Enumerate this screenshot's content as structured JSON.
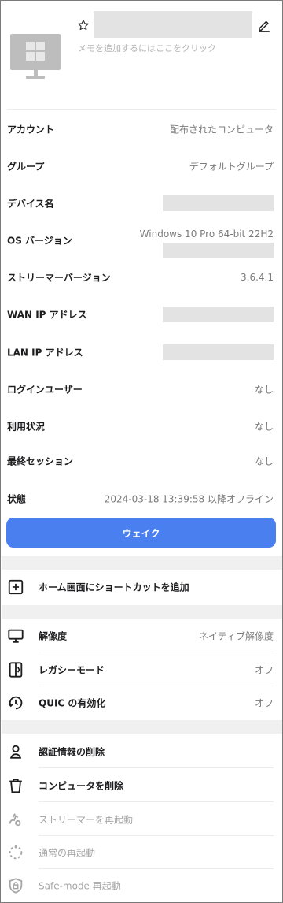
{
  "header": {
    "memo_placeholder": "メモを追加するにはここをクリック",
    "device_icon": "monitor-windows-icon",
    "star_icon": "star-outline-icon",
    "edit_icon": "pencil-icon"
  },
  "info": {
    "account": {
      "label": "アカウント",
      "value": "配布されたコンピュータ"
    },
    "group": {
      "label": "グループ",
      "value": "デフォルトグループ"
    },
    "device_name": {
      "label": "デバイス名"
    },
    "os_version": {
      "label": "OS バージョン",
      "value": "Windows 10 Pro 64-bit 22H2"
    },
    "streamer_version": {
      "label": "ストリーマーバージョン",
      "value": "3.6.4.1"
    },
    "wan_ip": {
      "label": "WAN IP アドレス"
    },
    "lan_ip": {
      "label": "LAN IP アドレス"
    },
    "login_user": {
      "label": "ログインユーザー",
      "value": "なし"
    },
    "usage": {
      "label": "利用状況",
      "value": "なし"
    },
    "last_session": {
      "label": "最終セッション",
      "value": "なし"
    },
    "status": {
      "label": "状態",
      "value": "2024-03-18 13:39:58 以降オフライン"
    }
  },
  "wake_button": {
    "label": "ウェイク"
  },
  "actions": {
    "add_shortcut": {
      "label": "ホーム画面にショートカットを追加",
      "icon": "plus-box-icon"
    },
    "resolution": {
      "label": "解像度",
      "value": "ネイティブ解像度",
      "icon": "monitor-icon"
    },
    "legacy_mode": {
      "label": "レガシーモード",
      "value": "オフ",
      "icon": "legacy-mode-icon"
    },
    "quic": {
      "label": "QUIC の有効化",
      "value": "オフ",
      "icon": "quic-icon"
    },
    "delete_credentials": {
      "label": "認証情報の削除",
      "icon": "user-icon"
    },
    "delete_computer": {
      "label": "コンピュータを削除",
      "icon": "trash-icon"
    },
    "restart_streamer": {
      "label": "ストリーマーを再起動",
      "icon": "streamer-restart-icon"
    },
    "normal_restart": {
      "label": "通常の再起動",
      "icon": "restart-icon"
    },
    "safe_mode_restart": {
      "label": "Safe-mode 再起動",
      "icon": "safe-mode-icon"
    }
  }
}
